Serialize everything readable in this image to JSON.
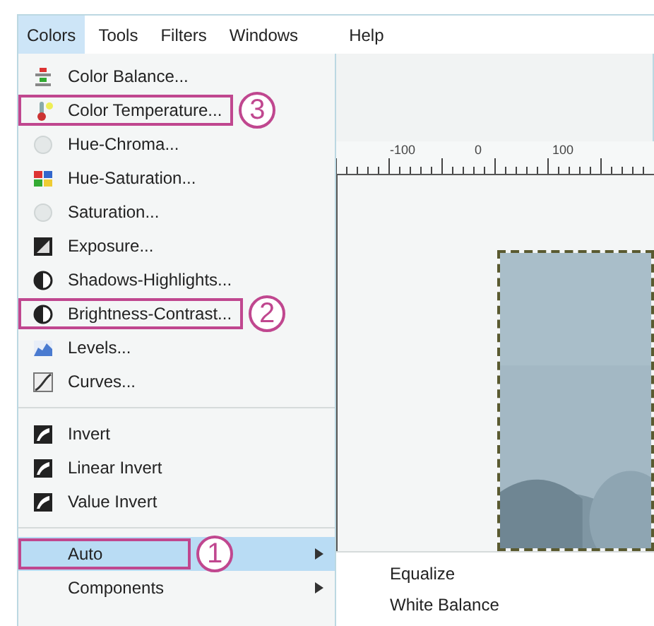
{
  "menubar": [
    {
      "label": "Colors",
      "selected": true
    },
    {
      "label": "Tools",
      "selected": false
    },
    {
      "label": "Filters",
      "selected": false
    },
    {
      "label": "Windows",
      "selected": false
    },
    {
      "label": "Help",
      "selected": false
    }
  ],
  "menu": {
    "groups": [
      {
        "items": [
          {
            "label": "Color Balance...",
            "selected": false
          },
          {
            "label": "Color Temperature...",
            "selected": false,
            "callout": "3"
          },
          {
            "label": "Hue-Chroma...",
            "selected": false
          },
          {
            "label": "Hue-Saturation...",
            "selected": false
          },
          {
            "label": "Saturation...",
            "selected": false
          },
          {
            "label": "Exposure...",
            "selected": false
          },
          {
            "label": "Shadows-Highlights...",
            "selected": false
          },
          {
            "label": "Brightness-Contrast...",
            "selected": false,
            "callout": "2"
          },
          {
            "label": "Levels...",
            "selected": false
          },
          {
            "label": "Curves...",
            "selected": false
          }
        ]
      },
      {
        "items": [
          {
            "label": "Invert",
            "selected": false
          },
          {
            "label": "Linear Invert",
            "selected": false
          },
          {
            "label": "Value Invert",
            "selected": false
          }
        ]
      },
      {
        "items": [
          {
            "label": "Auto",
            "selected": true,
            "submenu": true,
            "callout": "1"
          },
          {
            "label": "Components",
            "selected": false,
            "submenu": true
          }
        ]
      }
    ]
  },
  "ruler": {
    "labels": [
      "-100",
      "0",
      "100"
    ]
  },
  "submenu": {
    "items": [
      {
        "label": "Equalize"
      },
      {
        "label": "White Balance"
      }
    ]
  }
}
